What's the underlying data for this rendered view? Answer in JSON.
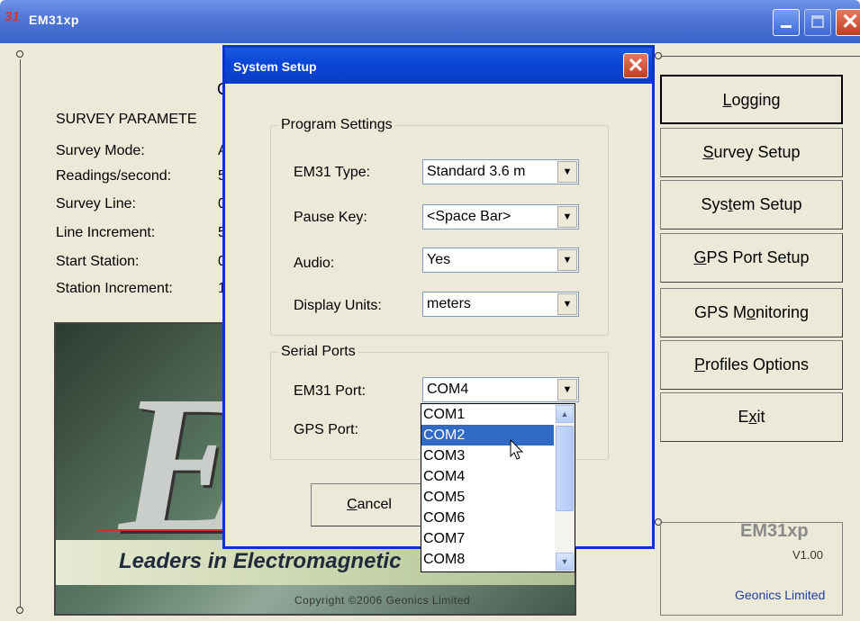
{
  "main_window": {
    "title": "EM31xp",
    "icon_text": "31",
    "survey_params_heading": "SURVEY PARAMETE",
    "partial_heading_char": "C",
    "params": [
      {
        "label": "Survey Mode:",
        "value": "A"
      },
      {
        "label": "Readings/second:",
        "value": "5"
      },
      {
        "label": "Survey Line:",
        "value": "0"
      },
      {
        "label": "Line Increment:",
        "value": "5"
      },
      {
        "label": "Start Station:",
        "value": "0"
      },
      {
        "label": "Station Increment:",
        "value": "1"
      }
    ],
    "logo": {
      "letters": "EM",
      "tagline": "Leaders in Electromagnetic",
      "copyright": "Copyright ©2006 Geonics Limited"
    },
    "buttons": [
      {
        "label": "Logging",
        "mnemonic": "L",
        "rest": "ogging"
      },
      {
        "label": "Survey Setup",
        "mnemonic": "S",
        "rest": "urvey Setup"
      },
      {
        "label": "System Setup",
        "pre": "Sys",
        "mnemonic": "t",
        "rest": "em Setup"
      },
      {
        "label": "GPS Port Setup",
        "mnemonic": "G",
        "rest": "PS Port Setup"
      },
      {
        "label": "GPS Monitoring",
        "pre": "GPS M",
        "mnemonic": "o",
        "rest": "nitoring"
      },
      {
        "label": "Profiles Options",
        "mnemonic": "P",
        "rest": "rofiles Options"
      },
      {
        "label": "Exit",
        "pre": "E",
        "mnemonic": "x",
        "rest": "it"
      }
    ],
    "app_name": "EM31xp",
    "version": "V1.00",
    "company": "Geonics Limited"
  },
  "dialog": {
    "title": "System Setup",
    "program_settings": {
      "legend": "Program Settings",
      "fields": [
        {
          "label": "EM31 Type:",
          "value": "Standard 3.6 m"
        },
        {
          "label": "Pause Key:",
          "value": "<Space Bar>"
        },
        {
          "label": "Audio:",
          "value": "Yes"
        },
        {
          "label": "Display Units:",
          "value": "meters"
        }
      ]
    },
    "serial_ports": {
      "legend": "Serial Ports",
      "em31_port_label": "EM31 Port:",
      "em31_port_value": "COM4",
      "gps_port_label": "GPS Port:"
    },
    "cancel_label": "Cancel",
    "cancel_mnemonic": "C",
    "cancel_rest": "ancel",
    "dropdown_options": [
      "COM1",
      "COM2",
      "COM3",
      "COM4",
      "COM5",
      "COM6",
      "COM7",
      "COM8"
    ],
    "dropdown_selected": "COM2"
  },
  "colors": {
    "titlebar": "#3a63c9",
    "selection": "#316ac5",
    "window_bg": "#ece9d8",
    "company_text": "#1f3f9f"
  }
}
